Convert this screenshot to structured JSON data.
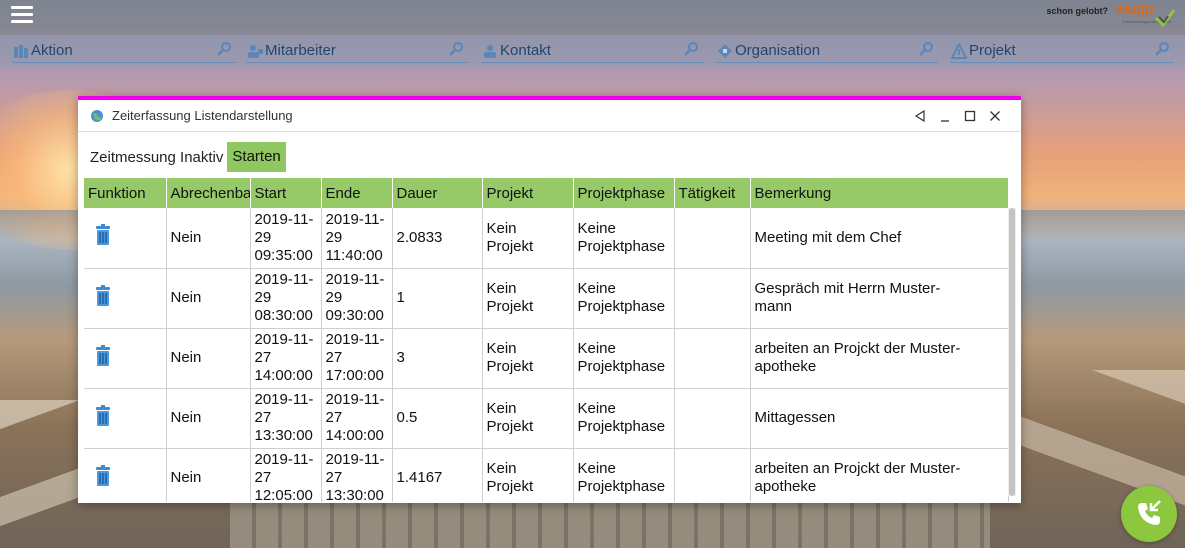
{
  "brand": {
    "tagline": "schon gelobt?",
    "logo_text": "wupp",
    "logo_subtext": "Zeiterfassungsmanagement"
  },
  "search": {
    "fields": [
      {
        "label": "Aktion",
        "icon": "action-icon"
      },
      {
        "label": "Mitarbeiter",
        "icon": "employee-icon"
      },
      {
        "label": "Kontakt",
        "icon": "contact-icon"
      },
      {
        "label": "Organisation",
        "icon": "organisation-icon"
      },
      {
        "label": "Projekt",
        "icon": "project-icon"
      }
    ]
  },
  "dialog": {
    "title": "Zeiterfassung Listendarstellung",
    "status": "Zeitmessung Inaktiv",
    "start_label": "Starten"
  },
  "table": {
    "headers": [
      "Funktion",
      "Abrechenbar",
      "Start",
      "Ende",
      "Dauer",
      "Projekt",
      "Projektphase",
      "Tätigkeit",
      "Bemerkung"
    ],
    "rows": [
      {
        "abrechenbar": "Nein",
        "start": "2019-11-\n29\n09:35:00",
        "ende": "2019-11-\n29\n11:40:00",
        "dauer": "2.0833",
        "projekt": "Kein\nProjekt",
        "projektphase": "Keine\nProjektphase",
        "taetigkeit": "",
        "bemerkung": "Meeting mit dem Chef"
      },
      {
        "abrechenbar": "Nein",
        "start": "2019-11-\n29\n08:30:00",
        "ende": "2019-11-\n29\n09:30:00",
        "dauer": "1",
        "projekt": "Kein\nProjekt",
        "projektphase": "Keine\nProjektphase",
        "taetigkeit": "",
        "bemerkung": "Gespräch mit Herrn Muster-\nmann"
      },
      {
        "abrechenbar": "Nein",
        "start": "2019-11-\n27\n14:00:00",
        "ende": "2019-11-\n27\n17:00:00",
        "dauer": "3",
        "projekt": "Kein\nProjekt",
        "projektphase": "Keine\nProjektphase",
        "taetigkeit": "",
        "bemerkung": "arbeiten an Projckt der Muster-\napotheke"
      },
      {
        "abrechenbar": "Nein",
        "start": "2019-11-\n27\n13:30:00",
        "ende": "2019-11-\n27\n14:00:00",
        "dauer": "0.5",
        "projekt": "Kein\nProjekt",
        "projektphase": "Keine\nProjektphase",
        "taetigkeit": "",
        "bemerkung": "Mittagessen"
      },
      {
        "abrechenbar": "Nein",
        "start": "2019-11-\n27\n12:05:00",
        "ende": "2019-11-\n27\n13:30:00",
        "dauer": "1.4167",
        "projekt": "Kein\nProjekt",
        "projektphase": "Keine\nProjektphase",
        "taetigkeit": "",
        "bemerkung": "arbeiten an Projckt der Muster-\napotheke"
      }
    ]
  },
  "colors": {
    "accent_green": "#96ca68",
    "dialog_border": "#ee00ee",
    "call_button": "#8dc63f",
    "field_text": "#24466d"
  }
}
